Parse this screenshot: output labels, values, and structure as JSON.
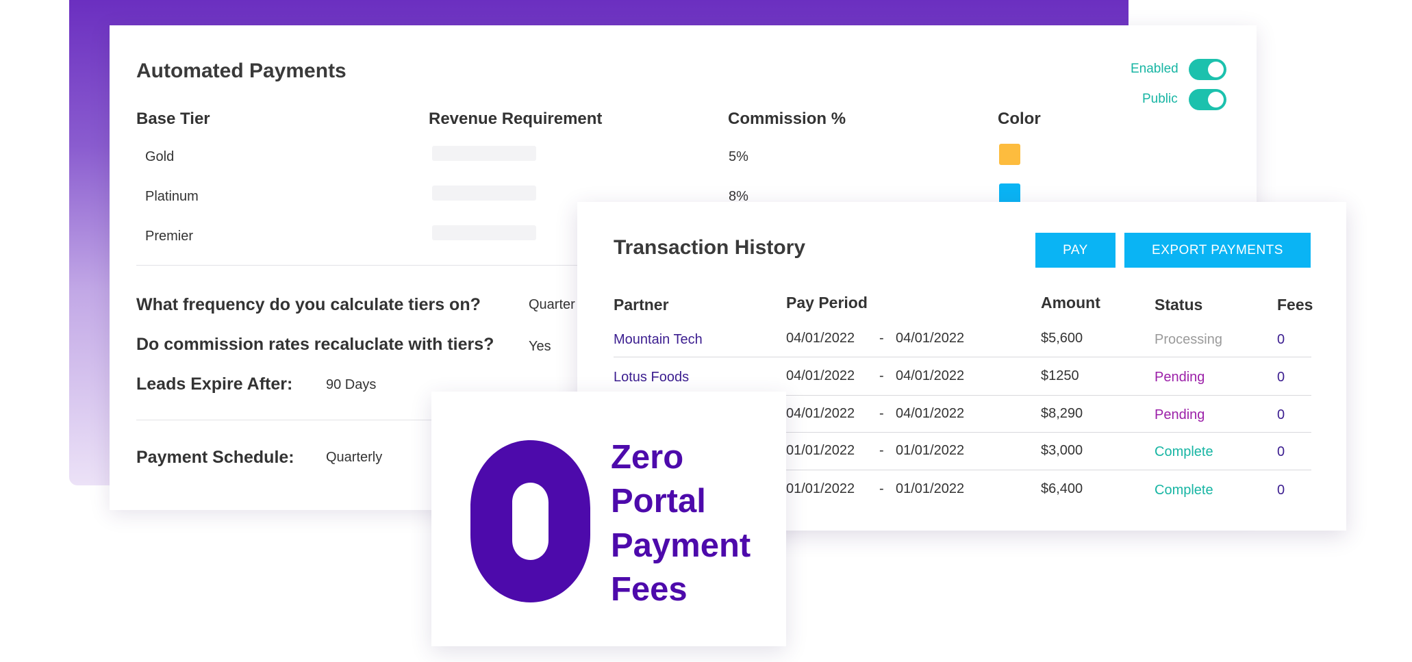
{
  "settings": {
    "title": "Automated Payments",
    "toggles": [
      {
        "label": "Enabled",
        "on": true
      },
      {
        "label": "Public",
        "on": true
      }
    ],
    "columns": [
      "Base Tier",
      "Revenue Requirement",
      "Commission %",
      "Color"
    ],
    "tiers": [
      {
        "name": "Gold",
        "commission": "5%",
        "color": "#fdbc3e"
      },
      {
        "name": "Platinum",
        "commission": "8%",
        "color": "#0ab4f4"
      },
      {
        "name": "Premier",
        "commission": "",
        "color": ""
      }
    ],
    "questions": [
      {
        "label": "What frequency do you calculate tiers on?",
        "value": "Quarter"
      },
      {
        "label": "Do commission rates recaluclate with tiers?",
        "value": "Yes"
      },
      {
        "label": "Leads Expire After:",
        "value": "90 Days"
      }
    ],
    "schedule": {
      "label": "Payment Schedule:",
      "value": "Quarterly"
    }
  },
  "transactions": {
    "title": "Transaction History",
    "buttons": {
      "pay": "PAY",
      "export": "EXPORT PAYMENTS"
    },
    "columns": [
      "Partner",
      "Pay Period",
      "Amount",
      "Status",
      "Fees"
    ],
    "rows": [
      {
        "partner": "Mountain Tech",
        "start": "04/01/2022",
        "sep": "-",
        "end": "04/01/2022",
        "amount": "$5,600",
        "status": "Processing",
        "status_color": "#9a9a9a",
        "fees": "0"
      },
      {
        "partner": "Lotus Foods",
        "start": "04/01/2022",
        "sep": "-",
        "end": "04/01/2022",
        "amount": "$1250",
        "status": "Pending",
        "status_color": "#9b1fa8",
        "fees": "0"
      },
      {
        "partner": "",
        "start": "04/01/2022",
        "sep": "-",
        "end": "04/01/2022",
        "amount": "$8,290",
        "status": "Pending",
        "status_color": "#9b1fa8",
        "fees": "0"
      },
      {
        "partner": "",
        "start": "01/01/2022",
        "sep": "-",
        "end": "01/01/2022",
        "amount": "$3,000",
        "status": "Complete",
        "status_color": "#17b5a3",
        "fees": "0"
      },
      {
        "partner": "",
        "start": "01/01/2022",
        "sep": "-",
        "end": "01/01/2022",
        "amount": "$6,400",
        "status": "Complete",
        "status_color": "#17b5a3",
        "fees": "0"
      }
    ]
  },
  "promo": {
    "lines": [
      "Zero",
      "Portal",
      "Payment",
      "Fees"
    ],
    "accent": "#4d0aab"
  }
}
